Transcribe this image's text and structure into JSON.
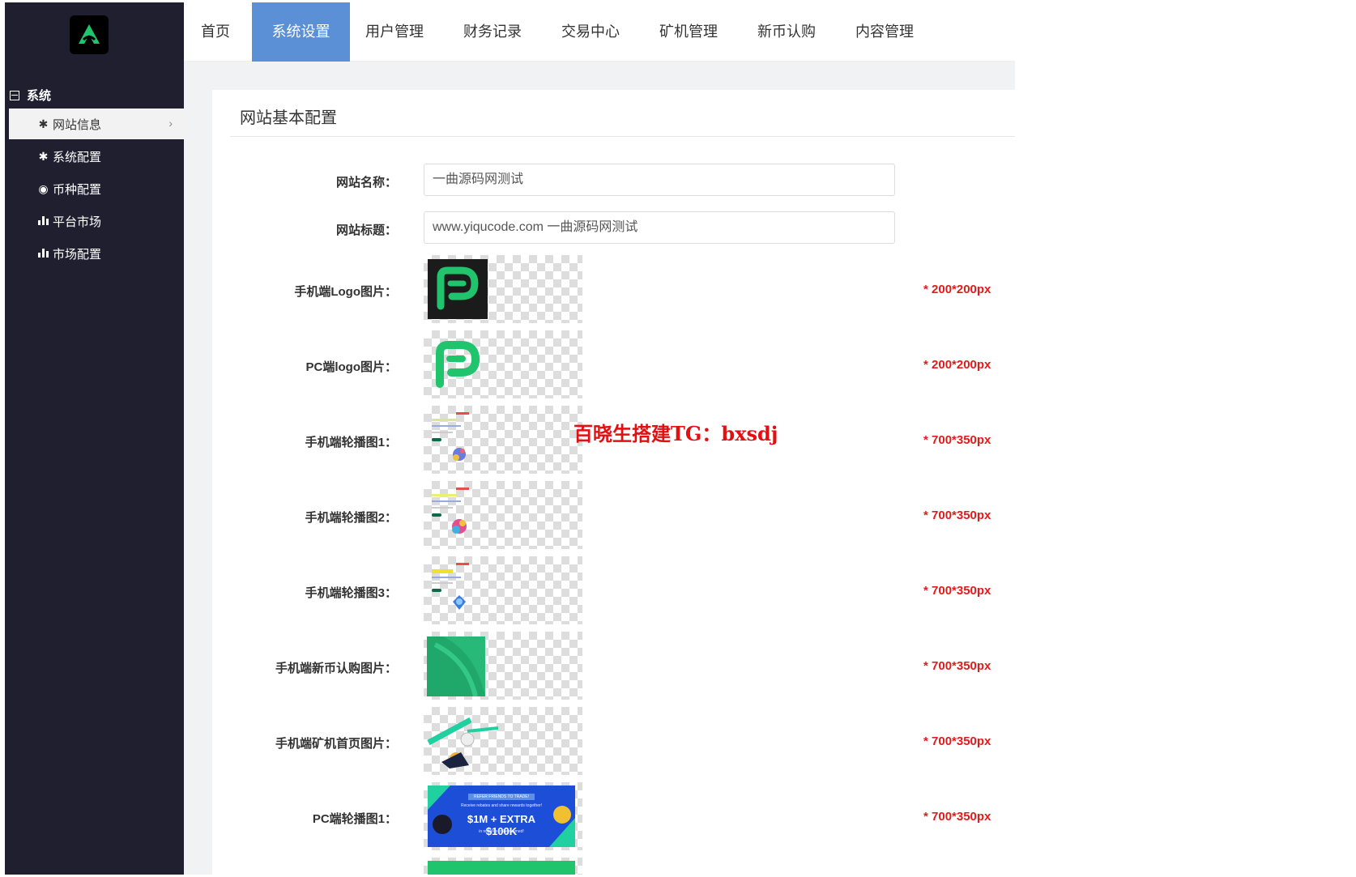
{
  "topnav": {
    "tabs": [
      {
        "label": "首页"
      },
      {
        "label": "系统设置"
      },
      {
        "label": "用户管理"
      },
      {
        "label": "财务记录"
      },
      {
        "label": "交易中心"
      },
      {
        "label": "矿机管理"
      },
      {
        "label": "新币认购"
      },
      {
        "label": "内容管理"
      }
    ],
    "active_tab": "系统设置",
    "active_color": "#5b8fd6"
  },
  "sidebar": {
    "group_label": "系统",
    "items": [
      {
        "label": "网站信息",
        "icon": "gear-icon",
        "active": true
      },
      {
        "label": "系统配置",
        "icon": "gear-icon"
      },
      {
        "label": "币种配置",
        "icon": "target-icon"
      },
      {
        "label": "平台市场",
        "icon": "bar-chart-icon"
      },
      {
        "label": "市场配置",
        "icon": "bar-chart-icon"
      }
    ]
  },
  "form": {
    "title": "网站基本配置",
    "site_name": {
      "label": "网站名称：",
      "value": "一曲源码网测试"
    },
    "site_title": {
      "label": "网站标题：",
      "value": "www.yiqucode.com 一曲源码网测试"
    },
    "images": [
      {
        "label": "手机端Logo图片：",
        "hint": "* 200*200px"
      },
      {
        "label": "PC端logo图片：",
        "hint": "* 200*200px"
      },
      {
        "label": "手机端轮播图1：",
        "hint": "* 700*350px"
      },
      {
        "label": "手机端轮播图2：",
        "hint": "* 700*350px"
      },
      {
        "label": "手机端轮播图3：",
        "hint": "* 700*350px"
      },
      {
        "label": "手机端新币认购图片：",
        "hint": "* 700*350px"
      },
      {
        "label": "手机端矿机首页图片：",
        "hint": "* 700*350px"
      },
      {
        "label": "PC端轮播图1：",
        "hint": "* 700*350px"
      }
    ],
    "banner_text": {
      "line1": "REFER FRIENDS TO TRADE!",
      "line2": "Receive rebates and share rewards together!",
      "amount": "$1M + EXTRA $100K",
      "line3": "in rewards to be claimed!"
    }
  },
  "watermark": "百晓生搭建TG：bxsdj",
  "colors": {
    "sidebar_bg": "#1f1f2f",
    "hint_red": "#e01b1b",
    "brand_green": "#1fc46d"
  }
}
